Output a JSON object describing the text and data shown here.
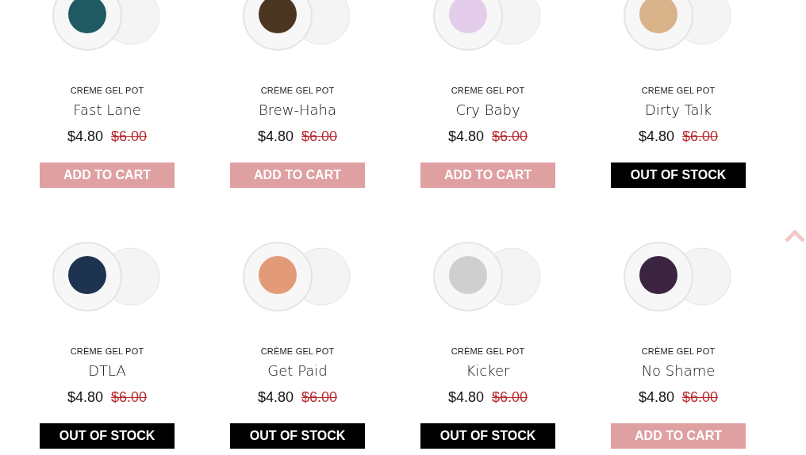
{
  "products": [
    {
      "category": "CRÈME GEL POT",
      "name": "Fast Lane",
      "price": "$4.80",
      "old_price": "$6.00",
      "color": "#1f5a63",
      "in_stock": true,
      "button": "ADD TO CART"
    },
    {
      "category": "CRÈME GEL POT",
      "name": "Brew-Haha",
      "price": "$4.80",
      "old_price": "$6.00",
      "color": "#4a3520",
      "in_stock": true,
      "button": "ADD TO CART"
    },
    {
      "category": "CRÈME GEL POT",
      "name": "Cry Baby",
      "price": "$4.80",
      "old_price": "$6.00",
      "color": "#e3cdea",
      "in_stock": true,
      "button": "ADD TO CART"
    },
    {
      "category": "CRÈME GEL POT",
      "name": "Dirty Talk",
      "price": "$4.80",
      "old_price": "$6.00",
      "color": "#d9b38a",
      "in_stock": false,
      "button": "OUT OF STOCK"
    },
    {
      "category": "CRÈME GEL POT",
      "name": "DTLA",
      "price": "$4.80",
      "old_price": "$6.00",
      "color": "#1e3350",
      "in_stock": false,
      "button": "OUT OF STOCK"
    },
    {
      "category": "CRÈME GEL POT",
      "name": "Get Paid",
      "price": "$4.80",
      "old_price": "$6.00",
      "color": "#e29a78",
      "in_stock": false,
      "button": "OUT OF STOCK"
    },
    {
      "category": "CRÈME GEL POT",
      "name": "Kicker",
      "price": "$4.80",
      "old_price": "$6.00",
      "color": "#cfcfcf",
      "in_stock": false,
      "button": "OUT OF STOCK"
    },
    {
      "category": "CRÈME GEL POT",
      "name": "No Shame",
      "price": "$4.80",
      "old_price": "$6.00",
      "color": "#3b2440",
      "in_stock": true,
      "button": "ADD TO CART"
    }
  ]
}
